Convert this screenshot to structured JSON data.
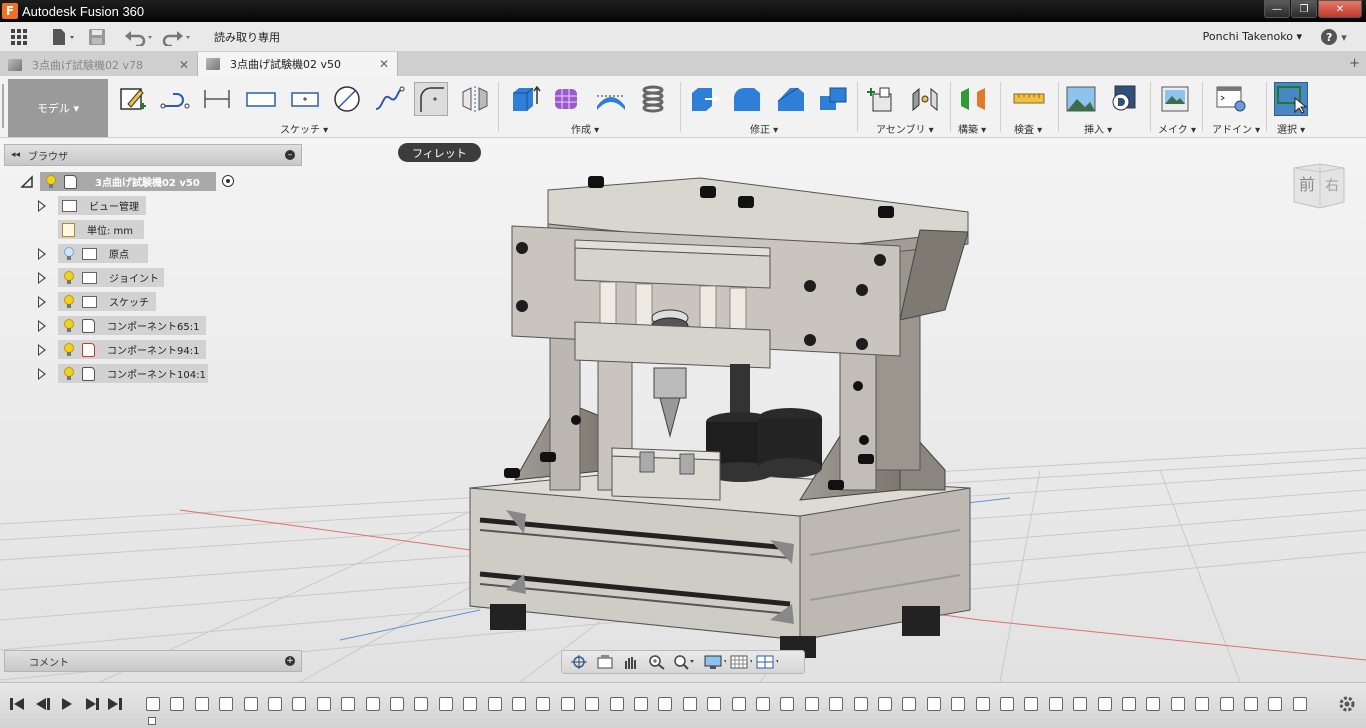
{
  "window": {
    "title": "Autodesk Fusion 360",
    "logo_letter": "F",
    "minimize": "—",
    "maximize": "❐",
    "close": "✕"
  },
  "quick_access": {
    "readonly_label": "読み取り専用",
    "user_name": "Ponchi Takenoko",
    "help": "?"
  },
  "tabs": [
    {
      "label": "3点曲げ試験機02 v78",
      "close": "✕"
    },
    {
      "label": "3点曲げ試験機02 v50",
      "close": "✕"
    }
  ],
  "tab_add": "+",
  "toolbar": {
    "workspace_label": "モデル ▾",
    "groups": {
      "sketch": "スケッチ ▾",
      "create": "作成 ▾",
      "modify": "修正 ▾",
      "assemble": "アセンブリ ▾",
      "construct": "構築 ▾",
      "inspect": "検査 ▾",
      "insert": "挿入 ▾",
      "make": "メイク ▾",
      "addins": "アドイン ▾",
      "select": "選択 ▾"
    },
    "tooltip": "フィレット"
  },
  "browser": {
    "title": "ブラウザ",
    "collapse": "◂◂",
    "minus": "–",
    "root": "3点曲げ試験機02 v50",
    "items": [
      {
        "label": "ビュー管理"
      },
      {
        "label": "単位: mm"
      },
      {
        "label": "原点"
      },
      {
        "label": "ジョイント"
      },
      {
        "label": "スケッチ"
      },
      {
        "label": "コンポーネント65:1"
      },
      {
        "label": "コンポーネント94:1"
      },
      {
        "label": "コンポーネント104:1"
      }
    ]
  },
  "comments": {
    "title": "コメント",
    "plus": "+"
  },
  "viewcube": {
    "front": "前",
    "right": "右"
  },
  "colors": {
    "accent_blue": "#4a86c5",
    "bulb_on": "#f2d21b",
    "model_gray": "#c9c6c0",
    "model_dark": "#2a2a2a"
  }
}
